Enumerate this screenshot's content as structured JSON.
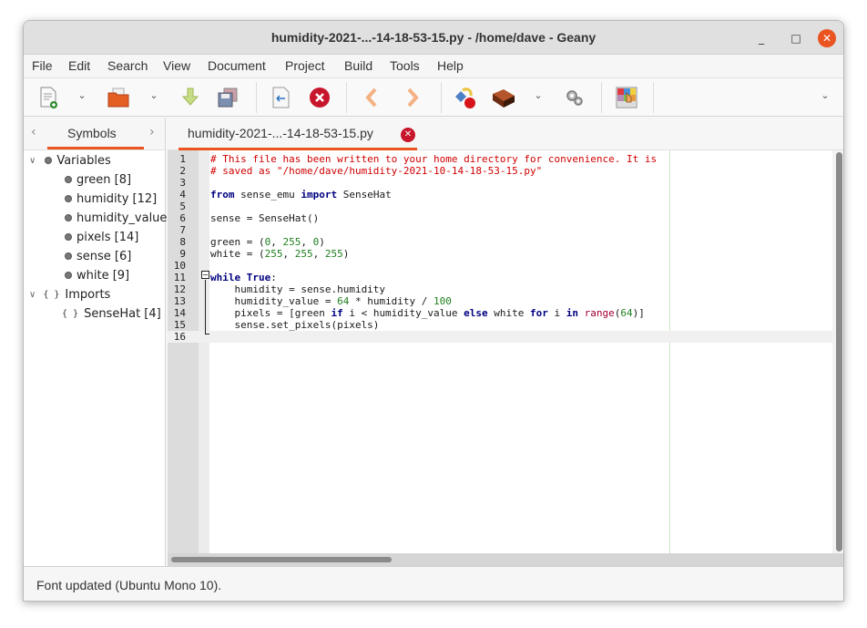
{
  "window": {
    "title": "humidity-2021-...-14-18-53-15.py - /home/dave - Geany",
    "minimize_icon": "minimize-icon",
    "maximize_icon": "maximize-icon",
    "close_icon": "close-icon",
    "min_glyph": "_",
    "max_glyph": "□",
    "close_glyph": "✕"
  },
  "menubar": {
    "items": [
      "File",
      "Edit",
      "Search",
      "View",
      "Document",
      "Project",
      "Build",
      "Tools",
      "Help"
    ]
  },
  "toolbar": {
    "items": [
      "new-file",
      "new-dropdown",
      "open-file",
      "open-dropdown",
      "save",
      "save-all",
      "revert",
      "close-file",
      "navigate-back",
      "navigate-forward",
      "compile",
      "build",
      "build-dropdown",
      "execute",
      "color-chooser",
      "overflow-dropdown"
    ],
    "chevron": "⌄"
  },
  "sidebar": {
    "tab_label": "Symbols",
    "prev_arrow": "‹",
    "next_arrow": "›",
    "tree": [
      {
        "label": "Variables",
        "type": "group",
        "icon": "variable-icon",
        "expanded": true
      },
      {
        "label": "green [8]",
        "type": "variable"
      },
      {
        "label": "humidity [12]",
        "type": "variable"
      },
      {
        "label": "humidity_value [",
        "type": "variable"
      },
      {
        "label": "pixels [14]",
        "type": "variable"
      },
      {
        "label": "sense [6]",
        "type": "variable"
      },
      {
        "label": "white [9]",
        "type": "variable"
      },
      {
        "label": "Imports",
        "type": "group",
        "icon": "import-icon",
        "expanded": true
      },
      {
        "label": "SenseHat [4]",
        "type": "import"
      }
    ],
    "expand_glyph": "∨",
    "brace_glyph": "{ }"
  },
  "document_tab": {
    "label": "humidity-2021-...-14-18-53-15.py",
    "close_glyph": "✕"
  },
  "editor": {
    "accent_underline": "#e95420",
    "current_line": 16,
    "lines": [
      {
        "n": "1",
        "segments": [
          [
            "c-comment",
            "# This file has been written to your home directory for convenience. It is"
          ]
        ]
      },
      {
        "n": "2",
        "segments": [
          [
            "c-comment",
            "# saved as \"/home/dave/humidity-2021-10-14-18-53-15.py\""
          ]
        ]
      },
      {
        "n": "3",
        "segments": []
      },
      {
        "n": "4",
        "segments": [
          [
            "c-kw",
            "from"
          ],
          [
            "",
            " sense_emu "
          ],
          [
            "c-kw",
            "import"
          ],
          [
            "",
            " SenseHat"
          ]
        ]
      },
      {
        "n": "5",
        "segments": []
      },
      {
        "n": "6",
        "segments": [
          [
            "",
            "sense = SenseHat()"
          ]
        ]
      },
      {
        "n": "7",
        "segments": []
      },
      {
        "n": "8",
        "segments": [
          [
            "",
            "green = ("
          ],
          [
            "c-num",
            "0"
          ],
          [
            "",
            ", "
          ],
          [
            "c-num",
            "255"
          ],
          [
            "",
            ", "
          ],
          [
            "c-num",
            "0"
          ],
          [
            "",
            ")"
          ]
        ]
      },
      {
        "n": "9",
        "segments": [
          [
            "",
            "white = ("
          ],
          [
            "c-num",
            "255"
          ],
          [
            "",
            ", "
          ],
          [
            "c-num",
            "255"
          ],
          [
            "",
            ", "
          ],
          [
            "c-num",
            "255"
          ],
          [
            "",
            ")"
          ]
        ]
      },
      {
        "n": "10",
        "segments": []
      },
      {
        "n": "11",
        "segments": [
          [
            "c-kw",
            "while"
          ],
          [
            "",
            " "
          ],
          [
            "c-kw",
            "True"
          ],
          [
            "",
            ":"
          ]
        ]
      },
      {
        "n": "12",
        "segments": [
          [
            "",
            "    humidity = sense.humidity"
          ]
        ]
      },
      {
        "n": "13",
        "segments": [
          [
            "",
            "    humidity_value = "
          ],
          [
            "c-num",
            "64"
          ],
          [
            "",
            " * humidity / "
          ],
          [
            "c-num",
            "100"
          ]
        ]
      },
      {
        "n": "14",
        "segments": [
          [
            "",
            "    pixels = [green "
          ],
          [
            "c-kw",
            "if"
          ],
          [
            "",
            " i < humidity_value "
          ],
          [
            "c-kw",
            "else"
          ],
          [
            "",
            " white "
          ],
          [
            "c-kw",
            "for"
          ],
          [
            "",
            " i "
          ],
          [
            "c-kw",
            "in"
          ],
          [
            "",
            " "
          ],
          [
            "c-builtin",
            "range"
          ],
          [
            "",
            "("
          ],
          [
            "c-num",
            "64"
          ],
          [
            "",
            ")]"
          ]
        ]
      },
      {
        "n": "15",
        "segments": [
          [
            "",
            "    sense.set_pixels(pixels)"
          ]
        ]
      },
      {
        "n": "16",
        "segments": []
      }
    ]
  },
  "statusbar": {
    "text": "Font updated (Ubuntu Mono 10)."
  }
}
